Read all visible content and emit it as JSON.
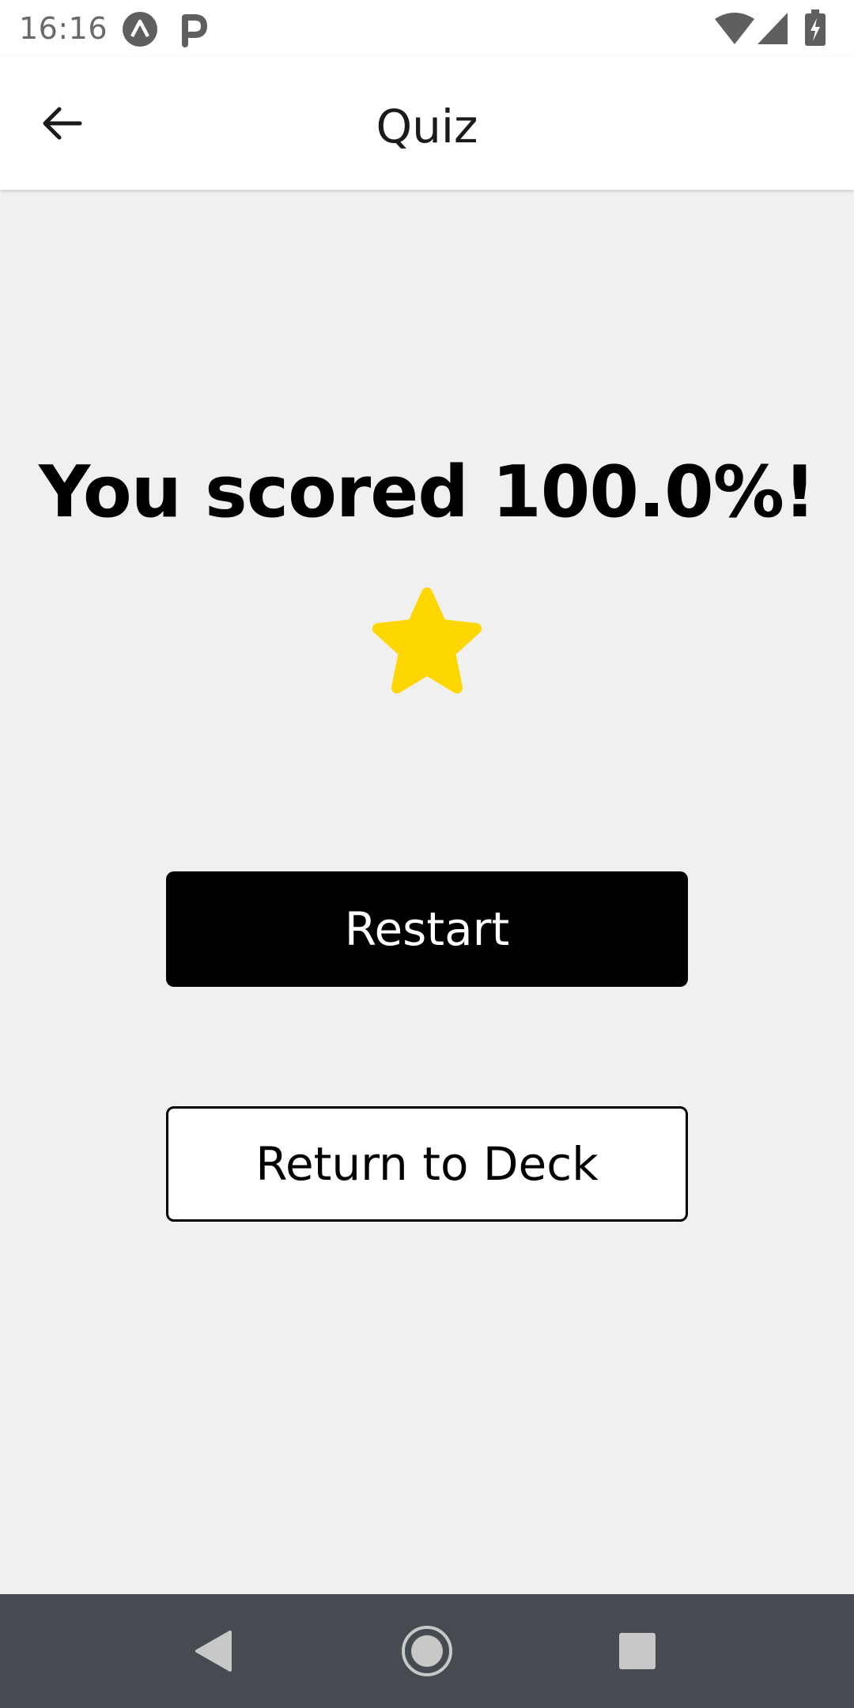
{
  "status_bar": {
    "time": "16:16",
    "icons": [
      "expo-icon",
      "parking-icon",
      "wifi-icon",
      "signal-icon",
      "battery-charging-icon"
    ]
  },
  "app_bar": {
    "title": "Quiz",
    "back_icon": "arrow-back-icon"
  },
  "result": {
    "score_text": "You scored 100.0%!",
    "star_icon": "star-icon",
    "star_color": "#FFD700"
  },
  "actions": {
    "restart_label": "Restart",
    "return_label": "Return to Deck"
  },
  "nav_bar": {
    "icons": [
      "nav-back-icon",
      "nav-home-icon",
      "nav-recents-icon"
    ]
  }
}
